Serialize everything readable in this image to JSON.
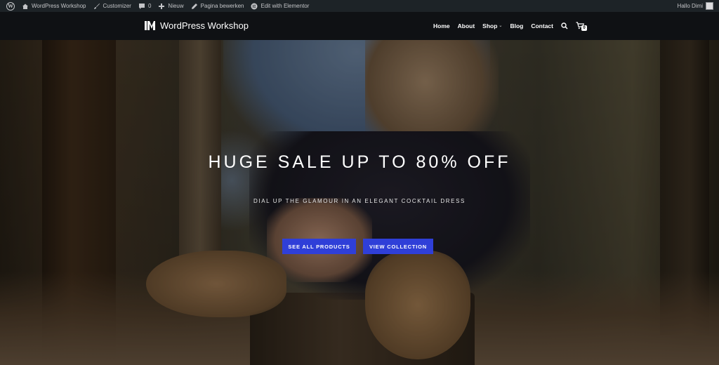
{
  "adminbar": {
    "items": [
      {
        "icon": "wordpress-logo-icon",
        "label": ""
      },
      {
        "icon": "home-icon",
        "label": "WordPress Workshop"
      },
      {
        "icon": "brush-icon",
        "label": "Customizer"
      },
      {
        "icon": "comment-icon",
        "label": "0"
      },
      {
        "icon": "plus-icon",
        "label": "Nieuw"
      },
      {
        "icon": "pencil-icon",
        "label": "Pagina bewerken"
      },
      {
        "icon": "elementor-icon",
        "label": "Edit with Elementor"
      }
    ],
    "greeting": "Hallo Dimi"
  },
  "header": {
    "site_title": "WordPress Workshop",
    "nav": [
      "Home",
      "About",
      "Shop",
      "Blog",
      "Contact"
    ],
    "cart_count": "0"
  },
  "hero": {
    "title": "HUGE SALE UP TO 80% OFF",
    "subtitle": "DIAL UP THE GLAMOUR IN AN ELEGANT COCKTAIL DRESS",
    "button_primary": "SEE ALL PRODUCTS",
    "button_secondary": "VIEW COLLECTION"
  },
  "colors": {
    "admin_bar": "#1d2327",
    "header_bg": "#0f1114",
    "button_accent": "#2f3fd8"
  }
}
